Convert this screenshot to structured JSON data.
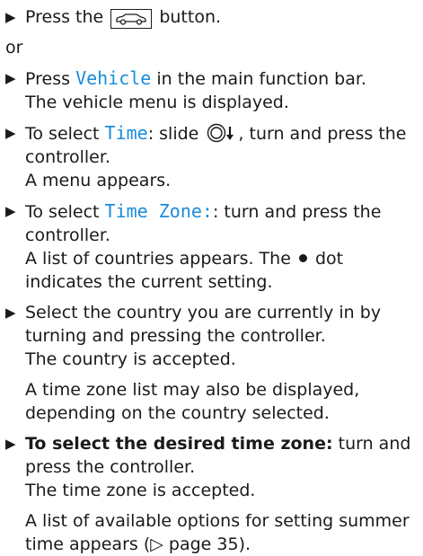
{
  "bullet_glyph": "▶",
  "steps": {
    "press_button": {
      "before": "Press the",
      "icon": "vehicle-button-icon",
      "after": "button."
    },
    "or": "or",
    "vehicle": {
      "before": "Press",
      "display": "Vehicle",
      "after": "in the main function bar.",
      "result": "The vehicle menu is displayed."
    },
    "time": {
      "before": "To select",
      "display": "Time",
      "middle": ": slide",
      "icon": "controller-slide-down-icon",
      "after": ", turn and press the controller.",
      "result": "A menu appears."
    },
    "time_zone": {
      "before": "To select",
      "display": "Time Zone:",
      "after": ": turn and press the controller.",
      "result_before": "A list of countries appears. The",
      "dot_icon": "dot-icon",
      "result_after": "dot indicates the current setting."
    },
    "country": {
      "text": "Select the country you are currently in by turning and pressing the controller.",
      "result": "The country is accepted.",
      "note": "A time zone list may also be displayed, depending on the country selected."
    },
    "desired_zone": {
      "bold": "To select the desired time zone:",
      "after": "turn and press the controller.",
      "result": "The time zone is accepted.",
      "note_before": "A list of available options for setting summer time appears (",
      "arrow": "▷",
      "note_page": "page 35",
      "note_after": ")."
    }
  }
}
